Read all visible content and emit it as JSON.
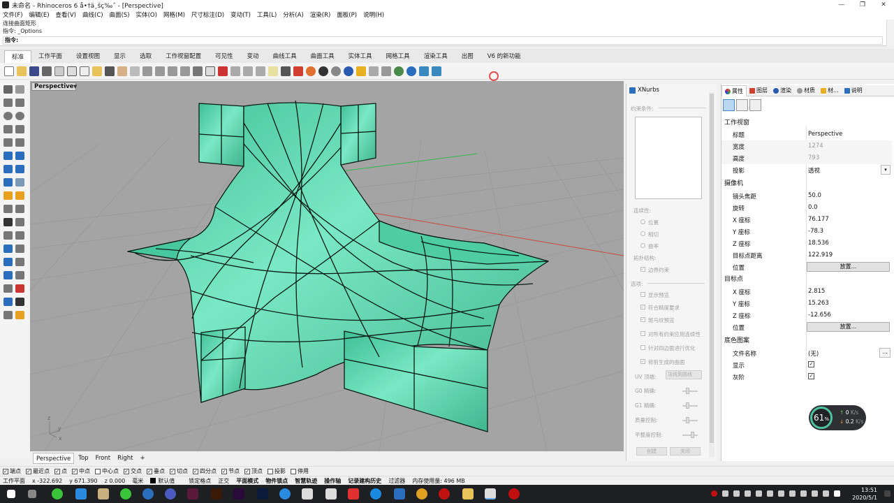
{
  "window": {
    "title": "未命名 - Rhinoceros 6 å•†ä¸šç‰ˆ - [Perspective]"
  },
  "menu": [
    "文件(F)",
    "编辑(E)",
    "查看(V)",
    "曲线(C)",
    "曲面(S)",
    "实体(O)",
    "网格(M)",
    "尺寸标注(D)",
    "变动(T)",
    "工具(L)",
    "分析(A)",
    "渲染(R)",
    "面板(P)",
    "说明(H)"
  ],
  "command": {
    "history1": "连接曲面矩形",
    "history2": "指令: _Options",
    "prompt": "指令:"
  },
  "tabs": [
    "标准",
    "工作平面",
    "设置视图",
    "显示",
    "选取",
    "工作视窗配置",
    "可见性",
    "变动",
    "曲线工具",
    "曲面工具",
    "实体工具",
    "网格工具",
    "渲染工具",
    "出图",
    "V6 的新功能"
  ],
  "viewport": {
    "label": "Perspective",
    "tabs": [
      "Perspective",
      "Top",
      "Front",
      "Right"
    ],
    "add_tab": "+",
    "axis_x": "x",
    "axis_y": "y",
    "axis_z": "z"
  },
  "xnurbs": {
    "title": "XNurbs",
    "constraints_label": "约束条件:",
    "continuity_label": "连续性:",
    "continuity_options": [
      "位置",
      "相切",
      "曲率"
    ],
    "topology_label": "拓扑结构:",
    "boundary_constraint": "边界约束",
    "options_label": "选项:",
    "options": [
      "显示预览",
      "符合精度要求",
      "斑马纹预览",
      "对所有约束应用连续性",
      "针对四边面进行优化",
      "修剪生成的曲面"
    ],
    "uv_label": "UV 顶端:",
    "uv_value": "法线到曲线",
    "g0_label": "G0 精确:",
    "g1_label": "G1 精确:",
    "quality_label": "质量控制:",
    "smooth_label": "平整度控制:",
    "create_btn": "创建",
    "close_btn": "关闭"
  },
  "properties": {
    "tabs": [
      "属性",
      "图层",
      "渲染",
      "材质",
      "材...",
      "说明"
    ],
    "viewport_section": "工作视窗",
    "title_key": "标题",
    "title_val": "Perspective",
    "width_key": "宽度",
    "width_val": "1274",
    "height_key": "高度",
    "height_val": "793",
    "proj_key": "投影",
    "proj_val": "透视",
    "camera_section": "摄像机",
    "lens_key": "镜头焦距",
    "lens_val": "50.0",
    "rot_key": "旋转",
    "rot_val": "0.0",
    "cx_key": "X 座标",
    "cx_val": "76.177",
    "cy_key": "Y 座标",
    "cy_val": "-78.3",
    "cz_key": "Z 座标",
    "cz_val": "18.536",
    "dist_key": "目标点距离",
    "dist_val": "122.919",
    "pos_key": "位置",
    "pos_btn": "放置...",
    "target_section": "目标点",
    "tx_key": "X 座标",
    "tx_val": "2.815",
    "ty_key": "Y 座标",
    "ty_val": "15.263",
    "tz_key": "Z 座标",
    "tz_val": "-12.656",
    "tpos_key": "位置",
    "tpos_btn": "放置...",
    "bg_section": "底色图案",
    "file_key": "文件名称",
    "file_val": "(无)",
    "show_key": "显示",
    "gray_key": "灰阶"
  },
  "speed": {
    "percent": "61",
    "unit": "%",
    "up": "0",
    "up_unit": "K/s",
    "down": "0.2",
    "down_unit": "K/s"
  },
  "osnap": [
    "端点",
    "最近点",
    "点",
    "中点",
    "中心点",
    "交点",
    "垂点",
    "切点",
    "四分点",
    "节点",
    "顶点",
    "投影",
    "停用"
  ],
  "osnap_checked": [
    true,
    true,
    true,
    true,
    false,
    true,
    true,
    true,
    true,
    true,
    true,
    false,
    false
  ],
  "status": {
    "cplane": "工作平面",
    "x": "x -322.692",
    "y": "y 671.390",
    "z": "z 0.000",
    "unit": "毫米",
    "layer": "默认值",
    "items": [
      "锁定格点",
      "正交",
      "平面模式",
      "物件锁点",
      "智慧轨迹",
      "操作轴",
      "记录建构历史",
      "过滤器"
    ],
    "memory": "内存使用量: 496 MB"
  },
  "taskbar": {
    "time": "13:51",
    "date": "2020/5/1"
  },
  "colors": {
    "surface": "#52d3a8",
    "viewport_bg": "#a4a4a4",
    "accent": "#2a6ebd"
  }
}
